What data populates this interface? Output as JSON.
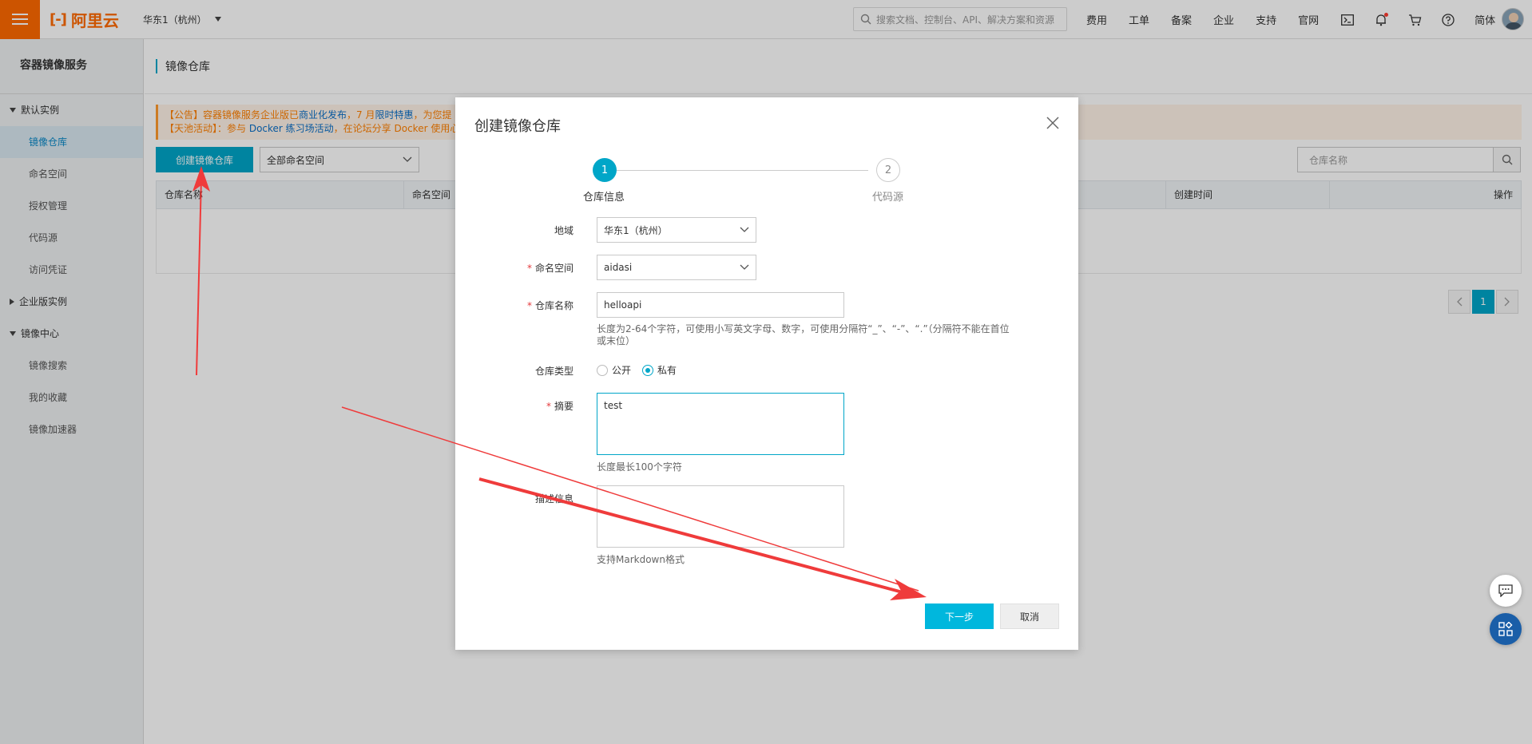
{
  "topbar": {
    "logo_text": "阿里云",
    "logo_mark": "[-]",
    "region": "华东1（杭州）",
    "search_placeholder": "搜索文档、控制台、API、解决方案和资源",
    "nav": [
      "费用",
      "工单",
      "备案",
      "企业",
      "支持",
      "官网"
    ],
    "lang": "简体"
  },
  "sidebar": {
    "title": "容器镜像服务",
    "groups": [
      {
        "label": "默认实例",
        "expanded": true,
        "items": [
          "镜像仓库",
          "命名空间",
          "授权管理",
          "代码源",
          "访问凭证"
        ]
      },
      {
        "label": "企业版实例",
        "expanded": false,
        "items": []
      },
      {
        "label": "镜像中心",
        "expanded": true,
        "items": [
          "镜像搜索",
          "我的收藏",
          "镜像加速器"
        ]
      }
    ],
    "active_item": "镜像仓库"
  },
  "main": {
    "breadcrumb": "镜像仓库",
    "notice_line1_prefix": "【公告】容器镜像服务企业版已",
    "notice_line1_link": "商业化发布",
    "notice_line1_mid": "，7 月",
    "notice_line1_link2": "限时特惠",
    "notice_line1_suffix": "，为您提",
    "notice_line2_prefix": "【天池活动】：参与 ",
    "notice_line2_link": "Docker 练习场活动",
    "notice_line2_suffix": "，在论坛分享 Docker 使用心",
    "create_button": "创建镜像仓库",
    "namespace_select": "全部命名空间",
    "repo_search_placeholder": "仓库名称",
    "table_headers": [
      "仓库名称",
      "命名空间",
      "创建时间",
      "操作"
    ],
    "pager_current": "1"
  },
  "modal": {
    "title": "创建镜像仓库",
    "steps": [
      {
        "number": "1",
        "label": "仓库信息"
      },
      {
        "number": "2",
        "label": "代码源"
      }
    ],
    "fields": {
      "region_label": "地域",
      "region_value": "华东1（杭州）",
      "namespace_label": "命名空间",
      "namespace_value": "aidasi",
      "repo_name_label": "仓库名称",
      "repo_name_value": "helloapi",
      "repo_name_hint": "长度为2-64个字符，可使用小写英文字母、数字，可使用分隔符“_”、“-”、“.”（分隔符不能在首位或末位）",
      "repo_type_label": "仓库类型",
      "repo_type_public": "公开",
      "repo_type_private": "私有",
      "repo_type_selected": "私有",
      "summary_label": "摘要",
      "summary_value": "test",
      "summary_hint": "长度最长100个字符",
      "description_label": "描述信息",
      "description_value": "",
      "description_hint": "支持Markdown格式"
    },
    "next_button": "下一步",
    "cancel_button": "取消"
  },
  "colors": {
    "brand_orange": "#ff6a00",
    "primary_teal": "#00a6c8",
    "annotation_red": "#ef3b3b"
  }
}
